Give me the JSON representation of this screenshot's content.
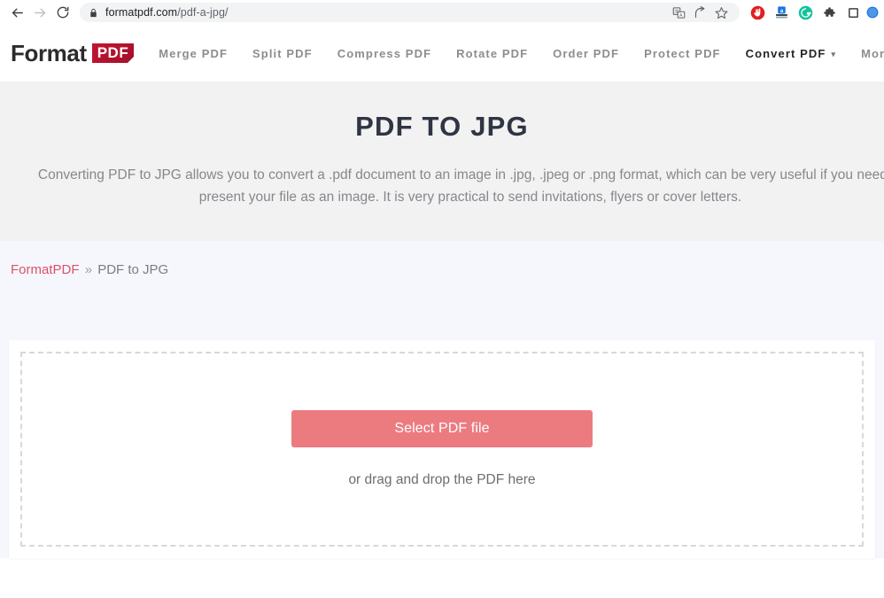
{
  "browser": {
    "back_icon": "arrow-left-icon",
    "forward_icon": "arrow-right-icon",
    "reload_icon": "reload-icon",
    "lock_icon": "lock-icon",
    "url_domain": "formatpdf.com",
    "url_path": "/pdf-a-jpg/",
    "omnibox_icons": [
      "translate-icon",
      "share-icon",
      "bookmark-star-icon"
    ],
    "extension_icons": [
      "adblock-icon",
      "blue-a-extension-icon",
      "grammarly-icon",
      "puzzle-extensions-icon",
      "square-panel-icon"
    ],
    "avatar_icon": "profile-avatar-icon"
  },
  "header": {
    "logo_word": "Format",
    "logo_badge": "PDF",
    "nav": [
      {
        "label": "Merge PDF",
        "active": false,
        "caret": ""
      },
      {
        "label": "Split PDF",
        "active": false,
        "caret": ""
      },
      {
        "label": "Compress PDF",
        "active": false,
        "caret": ""
      },
      {
        "label": "Rotate PDF",
        "active": false,
        "caret": ""
      },
      {
        "label": "Order PDF",
        "active": false,
        "caret": ""
      },
      {
        "label": "Protect PDF",
        "active": false,
        "caret": ""
      },
      {
        "label": "Convert PDF",
        "active": true,
        "caret": "▾"
      },
      {
        "label": "More To",
        "active": false,
        "caret": ""
      }
    ]
  },
  "hero": {
    "title": "PDF TO JPG",
    "description": "Converting PDF to JPG allows you to convert a .pdf document to an image in .jpg, .jpeg or .png format, which can be very useful if you need to present your file as an image. It is very practical to send invitations, flyers or cover letters."
  },
  "breadcrumb": {
    "home": "FormatPDF",
    "separator": "»",
    "current": "PDF to JPG"
  },
  "upload": {
    "button_label": "Select PDF file",
    "drag_text": "or drag and drop the PDF here",
    "button_color": "#ec7b80"
  },
  "colors": {
    "accent": "#ec7b80",
    "link": "#d9536a",
    "logo_badge": "#c31432",
    "hero_bg": "#f2f2f3",
    "section_bg": "#f5f7fd",
    "title": "#2f3542"
  }
}
